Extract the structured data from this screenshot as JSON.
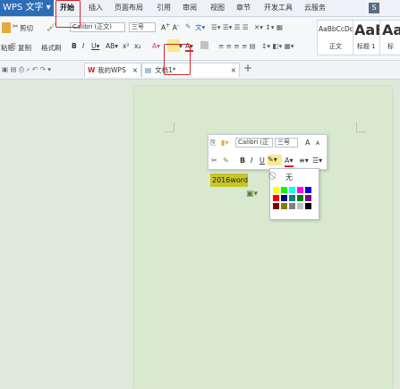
{
  "app": {
    "name": "WPS 文字",
    "arrow": "▾"
  },
  "menu": {
    "items": [
      "开始",
      "插入",
      "页面布局",
      "引用",
      "审阅",
      "视图",
      "章节",
      "开发工具",
      "云服务"
    ],
    "right_badge": "S"
  },
  "ribbon": {
    "cut_label": "剪切",
    "paste_label": "粘贴",
    "copy_label": "复制",
    "format_painter_label": "格式刷",
    "font_name": "Calibri (正文)",
    "font_size": "三号",
    "style_normal_preview": "AaBbCcDc",
    "style_normal_label": "正文",
    "style_h1_preview": "AaBl",
    "style_h1_label": "标题 1",
    "style_h2_preview": "Aa",
    "style_h2_label": "标"
  },
  "tabs": {
    "wps_tab": "我的WPS",
    "doc_tab": "文档1",
    "doc_modified": "*",
    "close": "×",
    "add": "+"
  },
  "minibar": {
    "font_name": "Calibri (正",
    "font_size": "三号",
    "grow": "A",
    "shrink": "A"
  },
  "document": {
    "selected_text": "2016word"
  },
  "highlight_dropdown": {
    "none_label": "无",
    "colors": [
      "#ffff00",
      "#00ff00",
      "#00ffff",
      "#ff00ff",
      "#0000ff",
      "#ff0000",
      "#000080",
      "#008080",
      "#008000",
      "#800080",
      "#800000",
      "#808000",
      "#808080",
      "#c0c0c0",
      "#000000"
    ]
  },
  "colors": {
    "brand_blue": "#2d6db5",
    "page_bg": "#d8e9cf",
    "highlight_yellow": "#c8c626",
    "annotation_red": "#d6242c"
  }
}
